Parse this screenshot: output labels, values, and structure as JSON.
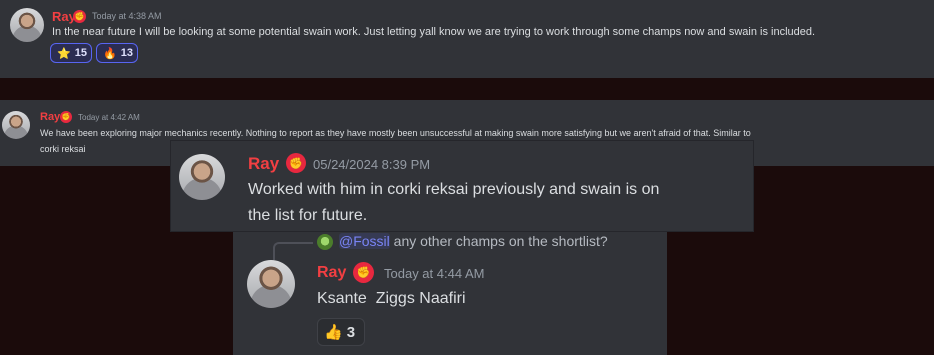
{
  "message1": {
    "author": "Ray",
    "timestamp": "Today at 4:38 AM",
    "text": "In the near future I will be looking at some potential swain work. Just letting yall know we are trying to work through some champs now and swain is included.",
    "reactions": [
      {
        "emoji": "⭐",
        "count": "15"
      },
      {
        "emoji": "🔥",
        "count": "13"
      }
    ]
  },
  "message2": {
    "author": "Ray",
    "timestamp": "Today at 4:42 AM",
    "text_line1": "We have been exploring major mechanics recently. Nothing to report as they have mostly been unsuccessful at making swain more satisfying but we aren't afraid of that. Similar to",
    "text_line2": "corki reksai"
  },
  "message3": {
    "author": "Ray",
    "timestamp": "05/24/2024 8:39 PM",
    "text_line1": "Worked with him in corki reksai previously and swain is on",
    "text_line2": "the list for future."
  },
  "message4": {
    "reply_mention": "@Fossil",
    "reply_text": "any other champs on the shortlist?",
    "author": "Ray",
    "timestamp": "Today at 4:44 AM",
    "text": "Ksante  Ziggs Naafiri",
    "reactions": [
      {
        "emoji": "👍",
        "count": "3"
      }
    ]
  },
  "badge_icon": "fist-icon",
  "colors": {
    "author": "#f23f42",
    "badge": "#e8283f",
    "panel": "#313338",
    "backdrop": "#1b0b0b"
  }
}
